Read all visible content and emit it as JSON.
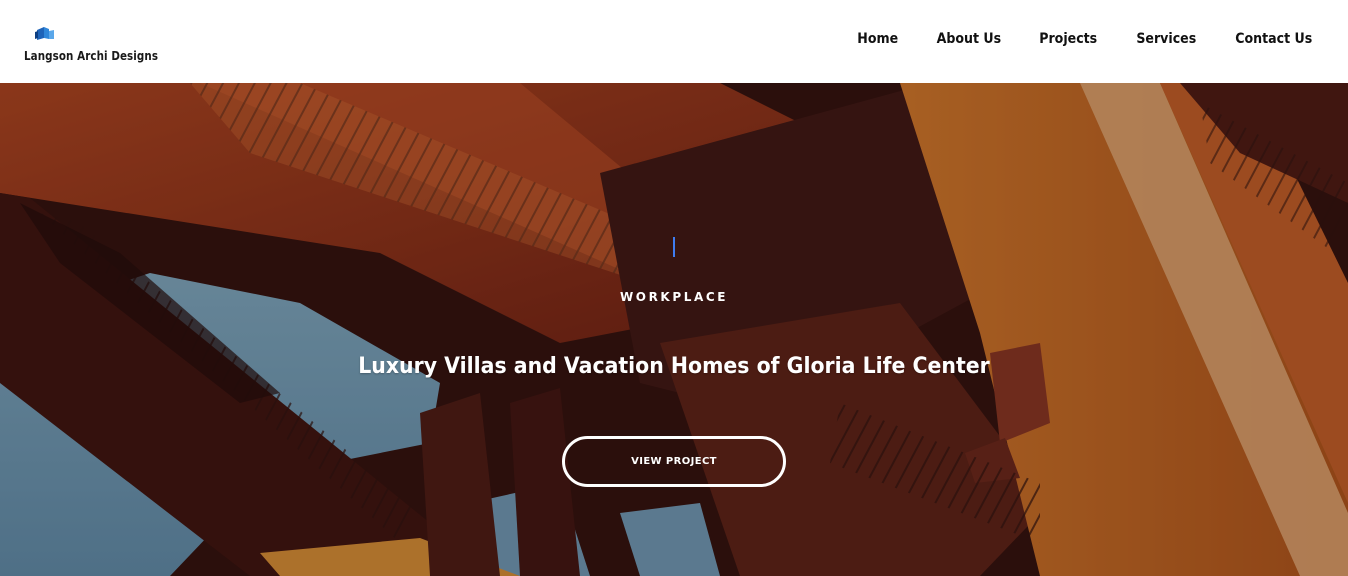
{
  "brand": {
    "name": "Langson Archi Designs",
    "logo_icon": "building-blocks-icon",
    "color": "#1e63b8"
  },
  "nav": {
    "items": [
      {
        "label": "Home"
      },
      {
        "label": "About Us"
      },
      {
        "label": "Projects"
      },
      {
        "label": "Services"
      },
      {
        "label": "Contact Us"
      }
    ]
  },
  "hero": {
    "eyebrow": "WORKPLACE",
    "headline": "Luxury Villas and Vacation Homes of Gloria Life Center",
    "cta_label": "VIEW PROJECT",
    "accent_color": "#3f7cf0",
    "background_image": "steel-structure-photo"
  }
}
